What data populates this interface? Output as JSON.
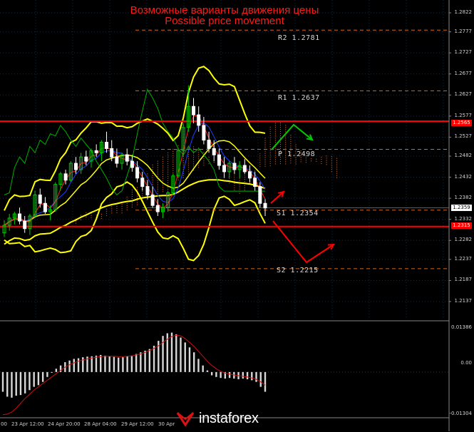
{
  "header": {
    "title_ru": "Возможные варианты движения цены",
    "title_en": "Possible price movement"
  },
  "levels": {
    "r2": "R2  1.2781",
    "r1": "R1  1.2637",
    "p": "P  1.2498",
    "s1": "S1  1.2354",
    "s2": "S2  1.2215"
  },
  "price_axis": [
    "1.2822",
    "1.2777",
    "1.2727",
    "1.2677",
    "1.2627",
    "1.2577",
    "1.2527",
    "1.2482",
    "1.2432",
    "1.2382",
    "1.2332",
    "1.2282",
    "1.2237",
    "1.2187",
    "1.2137"
  ],
  "price_tags": {
    "upper": "1.2565",
    "current": "1.2359",
    "lower": "1.2315"
  },
  "osc_axis": {
    "top": "0.01386",
    "mid": "0.00",
    "bottom": "-0.01304"
  },
  "time_axis": [
    "00",
    "23 Apr 12:00",
    "24 Apr 20:00",
    "28 Apr 04:00",
    "29 Apr 12:00",
    "30 Apr"
  ],
  "logo": "instaforex",
  "colors": {
    "background": "#000000",
    "title": "#ff1a1a",
    "resistance_line": "#ff0000",
    "pivot_lines": "#d2691e",
    "envelope": "#ffff00",
    "bullish_candle": "#00cc00",
    "bearish_candle": "#ffffff",
    "cloud_dots": "#d2691e",
    "green_arrow": "#00cc00",
    "red_arrow": "#ff0000"
  },
  "chart_data": {
    "type": "candlestick",
    "pivots": {
      "R2": 1.2781,
      "R1": 1.2637,
      "P": 1.2498,
      "S1": 1.2354,
      "S2": 1.2215
    },
    "horizontal_lines": [
      1.2565,
      1.2315
    ],
    "current_price": 1.2359,
    "ylim": [
      1.2137,
      1.2822
    ],
    "histogram_range": [
      -0.01304,
      0.01386
    ],
    "candles": [
      [
        1.23,
        1.233,
        1.229,
        1.2318
      ],
      [
        1.2318,
        1.2345,
        1.2305,
        1.2335
      ],
      [
        1.2335,
        1.235,
        1.232,
        1.2345
      ],
      [
        1.2345,
        1.236,
        1.232,
        1.2328
      ],
      [
        1.2328,
        1.234,
        1.23,
        1.231
      ],
      [
        1.231,
        1.2345,
        1.2295,
        1.234
      ],
      [
        1.234,
        1.24,
        1.2335,
        1.239
      ],
      [
        1.239,
        1.2405,
        1.236,
        1.237
      ],
      [
        1.237,
        1.2385,
        1.2345,
        1.235
      ],
      [
        1.235,
        1.2365,
        1.233,
        1.2355
      ],
      [
        1.2355,
        1.242,
        1.235,
        1.2415
      ],
      [
        1.2415,
        1.2445,
        1.24,
        1.244
      ],
      [
        1.244,
        1.245,
        1.2415,
        1.2425
      ],
      [
        1.2425,
        1.247,
        1.242,
        1.2465
      ],
      [
        1.2465,
        1.248,
        1.244,
        1.245
      ],
      [
        1.245,
        1.249,
        1.244,
        1.248
      ],
      [
        1.248,
        1.2495,
        1.246,
        1.247
      ],
      [
        1.247,
        1.25,
        1.2455,
        1.2495
      ],
      [
        1.2495,
        1.251,
        1.248,
        1.249
      ],
      [
        1.249,
        1.252,
        1.247,
        1.2515
      ],
      [
        1.2515,
        1.254,
        1.249,
        1.25
      ],
      [
        1.25,
        1.252,
        1.247,
        1.248
      ],
      [
        1.248,
        1.25,
        1.2455,
        1.2465
      ],
      [
        1.2465,
        1.249,
        1.245,
        1.2485
      ],
      [
        1.2485,
        1.25,
        1.246,
        1.247
      ],
      [
        1.247,
        1.2485,
        1.2445,
        1.2455
      ],
      [
        1.2455,
        1.247,
        1.242,
        1.243
      ],
      [
        1.243,
        1.2445,
        1.24,
        1.241
      ],
      [
        1.241,
        1.2425,
        1.238,
        1.239
      ],
      [
        1.239,
        1.241,
        1.236,
        1.2365
      ],
      [
        1.2365,
        1.238,
        1.234,
        1.235
      ],
      [
        1.235,
        1.237,
        1.2335,
        1.236
      ],
      [
        1.236,
        1.24,
        1.235,
        1.2395
      ],
      [
        1.2395,
        1.244,
        1.239,
        1.2435
      ],
      [
        1.2435,
        1.25,
        1.243,
        1.2495
      ],
      [
        1.2495,
        1.256,
        1.248,
        1.255
      ],
      [
        1.255,
        1.265,
        1.254,
        1.26
      ],
      [
        1.26,
        1.262,
        1.256,
        1.258
      ],
      [
        1.258,
        1.26,
        1.254,
        1.2555
      ],
      [
        1.2555,
        1.2575,
        1.251,
        1.252
      ],
      [
        1.252,
        1.254,
        1.249,
        1.25
      ],
      [
        1.25,
        1.252,
        1.247,
        1.2485
      ],
      [
        1.2485,
        1.25,
        1.245,
        1.246
      ],
      [
        1.246,
        1.248,
        1.243,
        1.2445
      ],
      [
        1.2445,
        1.247,
        1.243,
        1.2465
      ],
      [
        1.2465,
        1.248,
        1.244,
        1.245
      ],
      [
        1.245,
        1.247,
        1.243,
        1.246
      ],
      [
        1.246,
        1.2475,
        1.244,
        1.2445
      ],
      [
        1.2445,
        1.246,
        1.242,
        1.243
      ],
      [
        1.243,
        1.2445,
        1.24,
        1.241
      ],
      [
        1.241,
        1.242,
        1.236,
        1.237
      ],
      [
        1.237,
        1.238,
        1.234,
        1.2359
      ]
    ],
    "histogram": [
      -0.006,
      -0.0075,
      -0.0078,
      -0.0072,
      -0.007,
      -0.0065,
      -0.0055,
      -0.0045,
      -0.004,
      -0.003,
      -0.0015,
      0.0,
      0.001,
      0.002,
      0.003,
      0.0035,
      0.004,
      0.0042,
      0.0045,
      0.0047,
      0.0048,
      0.005,
      0.0052,
      0.005,
      0.0048,
      0.0046,
      0.0044,
      0.0045,
      0.0048,
      0.005,
      0.0055,
      0.006,
      0.0065,
      0.007,
      0.008,
      0.0095,
      0.011,
      0.0118,
      0.012,
      0.0115,
      0.0105,
      0.009,
      0.0075,
      0.006,
      0.004,
      0.002,
      0.0005,
      -0.001,
      -0.0015,
      -0.0018,
      -0.002,
      -0.0018,
      -0.002,
      -0.0022,
      -0.002,
      -0.0022,
      -0.0025,
      -0.003,
      -0.0045,
      -0.006
    ],
    "histogram_signal": [
      -0.013,
      -0.0128,
      -0.0122,
      -0.011,
      -0.0095,
      -0.008,
      -0.0068,
      -0.0055,
      -0.0045,
      -0.0035,
      -0.0025,
      -0.0015,
      -0.0005,
      0.0005,
      0.0015,
      0.0022,
      0.0028,
      0.0033,
      0.0037,
      0.004,
      0.0043,
      0.0045,
      0.0047,
      0.0048,
      0.0048,
      0.0048,
      0.0047,
      0.0047,
      0.0048,
      0.0049,
      0.0052,
      0.0055,
      0.006,
      0.0065,
      0.0072,
      0.008,
      0.009,
      0.01,
      0.0108,
      0.0112,
      0.011,
      0.0102,
      0.009,
      0.0078,
      0.0063,
      0.0048,
      0.0033,
      0.002,
      0.001,
      0.0002,
      -0.0003,
      -0.0006,
      -0.0009,
      -0.0011,
      -0.0013,
      -0.0015,
      -0.0018,
      -0.0022,
      -0.003,
      -0.004
    ]
  }
}
